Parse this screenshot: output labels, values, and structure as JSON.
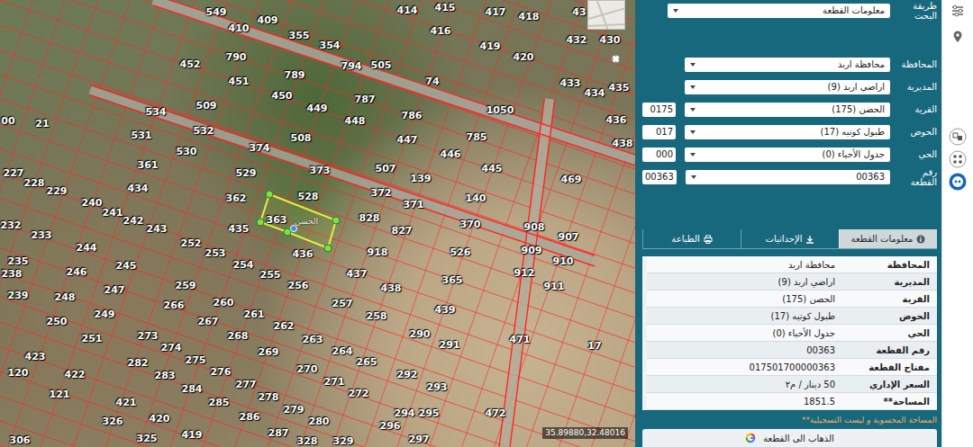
{
  "map": {
    "parcels": [
      {
        "number": "549",
        "selected": false
      },
      {
        "number": "409",
        "selected": false
      },
      {
        "number": "414",
        "selected": false
      },
      {
        "number": "415",
        "selected": false
      },
      {
        "number": "417",
        "selected": false
      },
      {
        "number": "418",
        "selected": false
      },
      {
        "number": "43",
        "selected": false
      },
      {
        "number": "410",
        "selected": false
      },
      {
        "number": "355",
        "selected": false
      },
      {
        "number": "354",
        "selected": false
      },
      {
        "number": "416",
        "selected": false
      },
      {
        "number": "419",
        "selected": false
      },
      {
        "number": "420",
        "selected": false
      },
      {
        "number": "432",
        "selected": false
      },
      {
        "number": "430",
        "selected": false
      },
      {
        "number": "790",
        "selected": false
      },
      {
        "number": "452",
        "selected": false
      },
      {
        "number": "794",
        "selected": false
      },
      {
        "number": "505",
        "selected": false
      },
      {
        "number": "789",
        "selected": false
      },
      {
        "number": "74",
        "selected": false
      },
      {
        "number": "433",
        "selected": false
      },
      {
        "number": "451",
        "selected": false
      },
      {
        "number": "435",
        "selected": false
      },
      {
        "number": "434",
        "selected": false
      },
      {
        "number": "450",
        "selected": false
      },
      {
        "number": "787",
        "selected": false
      },
      {
        "number": "449",
        "selected": false
      },
      {
        "number": "1050",
        "selected": false
      },
      {
        "number": "534",
        "selected": false
      },
      {
        "number": "509",
        "selected": false
      },
      {
        "number": "786",
        "selected": false
      },
      {
        "number": "448",
        "selected": false
      },
      {
        "number": "436",
        "selected": false
      },
      {
        "number": "21",
        "selected": false
      },
      {
        "number": "00",
        "selected": false
      },
      {
        "number": "532",
        "selected": false
      },
      {
        "number": "531",
        "selected": false
      },
      {
        "number": "508",
        "selected": false
      },
      {
        "number": "785",
        "selected": false
      },
      {
        "number": "447",
        "selected": false
      },
      {
        "number": "438",
        "selected": false
      },
      {
        "number": "374",
        "selected": false
      },
      {
        "number": "530",
        "selected": false
      },
      {
        "number": "446",
        "selected": false
      },
      {
        "number": "361",
        "selected": false
      },
      {
        "number": "373",
        "selected": false
      },
      {
        "number": "507",
        "selected": false
      },
      {
        "number": "445",
        "selected": false
      },
      {
        "number": "529",
        "selected": false
      },
      {
        "number": "227",
        "selected": false
      },
      {
        "number": "469",
        "selected": false
      },
      {
        "number": "139",
        "selected": false
      },
      {
        "number": "228",
        "selected": false
      },
      {
        "number": "434",
        "selected": false
      },
      {
        "number": "229",
        "selected": false
      },
      {
        "number": "372",
        "selected": false
      },
      {
        "number": "528",
        "selected": false
      },
      {
        "number": "362",
        "selected": false
      },
      {
        "number": "140",
        "selected": false
      },
      {
        "number": "240",
        "selected": false
      },
      {
        "number": "371",
        "selected": false
      },
      {
        "number": "241",
        "selected": false
      },
      {
        "number": "828",
        "selected": false
      },
      {
        "number": "363",
        "selected": true
      },
      {
        "number": "242",
        "selected": false
      },
      {
        "number": "370",
        "selected": false
      },
      {
        "number": "232",
        "selected": false
      },
      {
        "number": "908",
        "selected": false
      },
      {
        "number": "435",
        "selected": false
      },
      {
        "number": "243",
        "selected": false
      },
      {
        "number": "827",
        "selected": false
      },
      {
        "number": "233",
        "selected": false
      },
      {
        "number": "907",
        "selected": false
      },
      {
        "number": "252",
        "selected": false
      },
      {
        "number": "244",
        "selected": false
      },
      {
        "number": "909",
        "selected": false
      },
      {
        "number": "918",
        "selected": false
      },
      {
        "number": "526",
        "selected": false
      },
      {
        "number": "253",
        "selected": false
      },
      {
        "number": "436",
        "selected": false
      },
      {
        "number": "235",
        "selected": false
      },
      {
        "number": "910",
        "selected": false
      },
      {
        "number": "254",
        "selected": false
      },
      {
        "number": "245",
        "selected": false
      },
      {
        "number": "246",
        "selected": false
      },
      {
        "number": "912",
        "selected": false
      },
      {
        "number": "437",
        "selected": false
      },
      {
        "number": "238",
        "selected": false
      },
      {
        "number": "255",
        "selected": false
      },
      {
        "number": "365",
        "selected": false
      },
      {
        "number": "259",
        "selected": false
      },
      {
        "number": "256",
        "selected": false
      },
      {
        "number": "911",
        "selected": false
      },
      {
        "number": "438",
        "selected": false
      },
      {
        "number": "247",
        "selected": false
      },
      {
        "number": "239",
        "selected": false
      },
      {
        "number": "248",
        "selected": false
      },
      {
        "number": "260",
        "selected": false
      },
      {
        "number": "257",
        "selected": false
      },
      {
        "number": "266",
        "selected": false
      },
      {
        "number": "439",
        "selected": false
      },
      {
        "number": "249",
        "selected": false
      },
      {
        "number": "261",
        "selected": false
      },
      {
        "number": "258",
        "selected": false
      },
      {
        "number": "267",
        "selected": false
      },
      {
        "number": "250",
        "selected": false
      },
      {
        "number": "262",
        "selected": false
      },
      {
        "number": "290",
        "selected": false
      },
      {
        "number": "273",
        "selected": false
      },
      {
        "number": "268",
        "selected": false
      },
      {
        "number": "251",
        "selected": false
      },
      {
        "number": "263",
        "selected": false
      },
      {
        "number": "471",
        "selected": false
      },
      {
        "number": "291",
        "selected": false
      },
      {
        "number": "17",
        "selected": false
      },
      {
        "number": "274",
        "selected": false
      },
      {
        "number": "264",
        "selected": false
      },
      {
        "number": "269",
        "selected": false
      },
      {
        "number": "423",
        "selected": false
      },
      {
        "number": "275",
        "selected": false
      },
      {
        "number": "265",
        "selected": false
      },
      {
        "number": "282",
        "selected": false
      },
      {
        "number": "270",
        "selected": false
      },
      {
        "number": "276",
        "selected": false
      },
      {
        "number": "120",
        "selected": false
      },
      {
        "number": "292",
        "selected": false
      },
      {
        "number": "422",
        "selected": false
      },
      {
        "number": "283",
        "selected": false
      },
      {
        "number": "271",
        "selected": false
      },
      {
        "number": "277",
        "selected": false
      },
      {
        "number": "293",
        "selected": false
      },
      {
        "number": "284",
        "selected": false
      },
      {
        "number": "272",
        "selected": false
      },
      {
        "number": "121",
        "selected": false
      },
      {
        "number": "278",
        "selected": false
      },
      {
        "number": "285",
        "selected": false
      },
      {
        "number": "421",
        "selected": false
      },
      {
        "number": "279",
        "selected": false
      },
      {
        "number": "294",
        "selected": false
      },
      {
        "number": "295",
        "selected": false
      },
      {
        "number": "472",
        "selected": false
      },
      {
        "number": "420",
        "selected": false
      },
      {
        "number": "286",
        "selected": false
      },
      {
        "number": "326",
        "selected": false
      },
      {
        "number": "280",
        "selected": false
      },
      {
        "number": "296",
        "selected": false
      },
      {
        "number": "287",
        "selected": false
      },
      {
        "number": "325",
        "selected": false
      },
      {
        "number": "419",
        "selected": false
      },
      {
        "number": "297",
        "selected": false
      },
      {
        "number": "306",
        "selected": false
      },
      {
        "number": "328",
        "selected": false
      },
      {
        "number": "329",
        "selected": false
      }
    ],
    "place_label": "الحسن",
    "coordinates": "35.89880,32.48016"
  },
  "search": {
    "label": "طريقة البحث",
    "value": "معلومات القطعة"
  },
  "fields": [
    {
      "kind": "select",
      "label": "المحافظة",
      "value": "محافظة اربد"
    },
    {
      "kind": "select",
      "label": "المديرية",
      "value": "اراضي اربد (9)"
    },
    {
      "kind": "coded-select",
      "label": "القرية",
      "code": "0175",
      "value": "الحصن (175)"
    },
    {
      "kind": "coded-select",
      "label": "الحوض",
      "code": "017",
      "value": "طبول كوتيه (17)"
    },
    {
      "kind": "coded-select",
      "label": "الحي",
      "code": "000",
      "value": "جدول الأحياء (0)"
    },
    {
      "kind": "coded-select",
      "label": "رقم القطعة",
      "code": "00363",
      "value": "00363"
    }
  ],
  "tabs": [
    {
      "label": "معلومات القطعة",
      "selected": true
    },
    {
      "label": "الإحداثيات",
      "selected": false
    },
    {
      "label": "الطباعة",
      "selected": false
    }
  ],
  "info": [
    {
      "label": "المحافظة",
      "value": "محافظة اربد"
    },
    {
      "label": "المديرية",
      "value": "اراضي اربد (9)"
    },
    {
      "label": "القرية",
      "value": "الحصن (175)"
    },
    {
      "label": "الحوض",
      "value": "طبول كوتيه (17)"
    },
    {
      "label": "الحي",
      "value": "جدول الأحياء (0)"
    },
    {
      "label": "رقم القطعة",
      "value": "00363"
    },
    {
      "label": "مفتاح القطعة",
      "value": "017501700000363"
    },
    {
      "label": "السعر الإداري",
      "value": "50 دينار / م٢"
    },
    {
      "label": "المساحة**",
      "value": "1851.5"
    }
  ],
  "note": "المساحة المحسوبة و ليست التسجيلية**",
  "goto_button": "الذهاب الى القطعة"
}
